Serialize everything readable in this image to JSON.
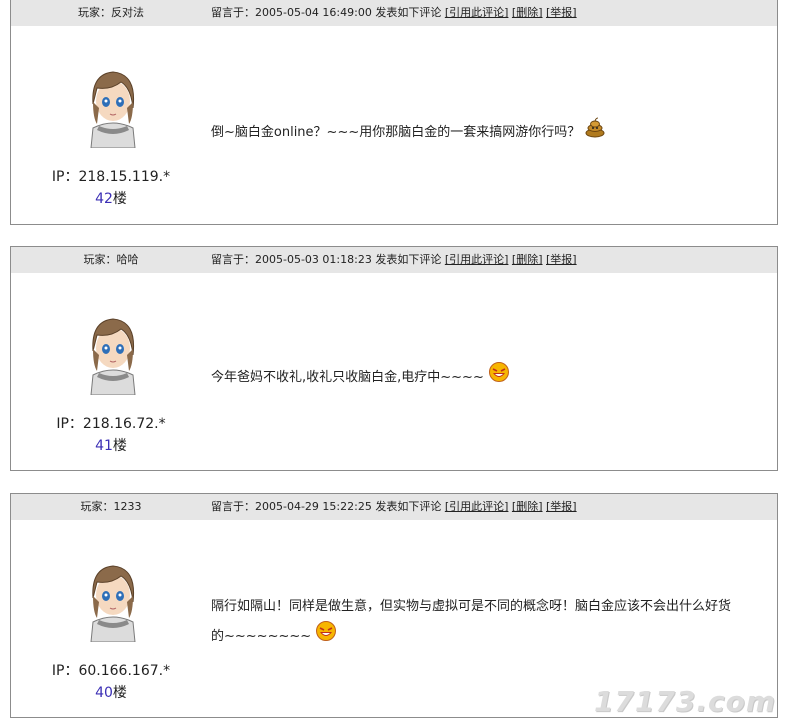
{
  "posts": [
    {
      "user_label": "玩家：反对法",
      "meta_prefix": "留言于：2005-05-04 16:49:00 发表如下评论",
      "actions": [
        "[引用此评论]",
        "[删除]",
        "[举报]"
      ],
      "ip": "IP：218.15.119.*",
      "floor_num": "42",
      "floor_suffix": "楼",
      "content_lines": [
        "倒~脑白金online？~~~用你那脑白金的一套来搞网游你行吗？"
      ],
      "emoji_icon": "poop-icon"
    },
    {
      "user_label": "玩家：哈哈",
      "meta_prefix": "留言于：2005-05-03 01:18:23 发表如下评论",
      "actions": [
        "[引用此评论]",
        "[删除]",
        "[举报]"
      ],
      "ip": "IP：218.16.72.*",
      "floor_num": "41",
      "floor_suffix": "楼",
      "content_lines": [
        "今年爸妈不收礼,收礼只收脑白金,电疗中~~~~"
      ],
      "emoji_icon": "laughing-face-icon"
    },
    {
      "user_label": "玩家：1233",
      "meta_prefix": "留言于：2005-04-29 15:22:25 发表如下评论",
      "actions": [
        "[引用此评论]",
        "[删除]",
        "[举报]"
      ],
      "ip": "IP：60.166.167.*",
      "floor_num": "40",
      "floor_suffix": "楼",
      "content_lines": [
        "隔行如隔山！同样是做生意，但实物与虚拟可是不同的概念呀！脑白金应该不会出什么好货",
        "的~~~~~~~~"
      ],
      "emoji_icon": "laughing-face-icon"
    }
  ],
  "watermark": "17173.com",
  "colors": {
    "header_bg": "#e6e6e6",
    "floor_num": "#3b2fb5",
    "border": "#8c8c8c"
  }
}
